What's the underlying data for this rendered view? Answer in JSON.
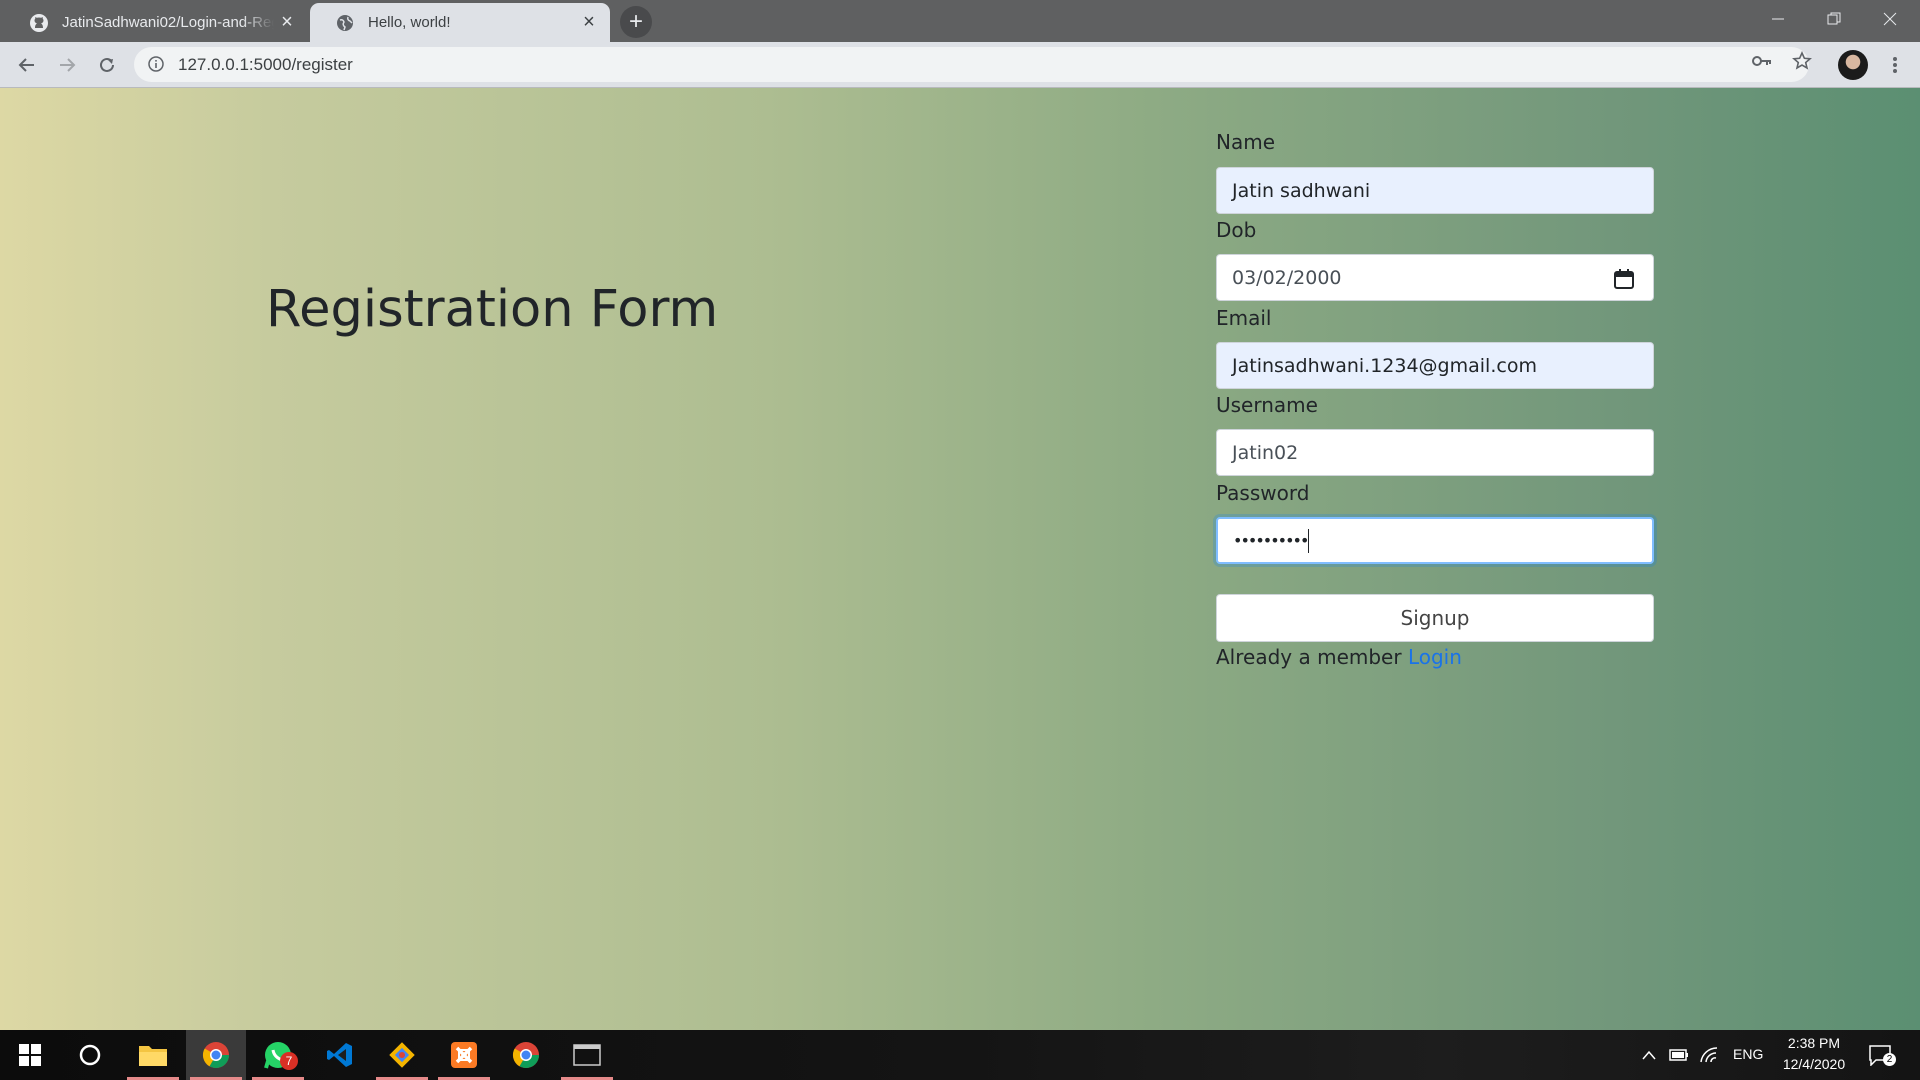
{
  "browser": {
    "tabs": [
      {
        "title": "JatinSadhwani02/Login-and-Registration",
        "icon": "github-icon",
        "active": false
      },
      {
        "title": "Hello, world!",
        "icon": "globe-icon",
        "active": true
      }
    ],
    "new_tab_label": "+",
    "url": "127.0.0.1:5000/register"
  },
  "page": {
    "title": "Registration Form",
    "fields": [
      {
        "label": "Name",
        "value": "Jatin sadhwani"
      },
      {
        "label": "Dob",
        "value": "03/02/2000"
      },
      {
        "label": "Email",
        "value": "Jatinsadhwani.1234@gmail.com"
      },
      {
        "label": "Username",
        "value": "Jatin02"
      },
      {
        "label": "Password",
        "value": "••••••••••"
      }
    ],
    "signup_label": "Signup",
    "member_text": "Already a member",
    "login_link": "Login"
  },
  "taskbar": {
    "apps": [
      "start-icon",
      "cortana-icon",
      "file-explorer-icon",
      "chrome-icon",
      "whatsapp-icon",
      "vscode-icon",
      "git-icon",
      "xampp-icon",
      "chrome-icon",
      "terminal-icon"
    ],
    "whatsapp_badge": "7",
    "language": "ENG",
    "time": "2:38 PM",
    "date": "12/4/2020",
    "notifications": "2"
  },
  "colors": {
    "link": "#1a73e8",
    "autofill": "#e8f0fe",
    "focus_ring": "#80bdff",
    "gradient_start": "#ddd8a4",
    "gradient_end": "#5b8f72"
  }
}
